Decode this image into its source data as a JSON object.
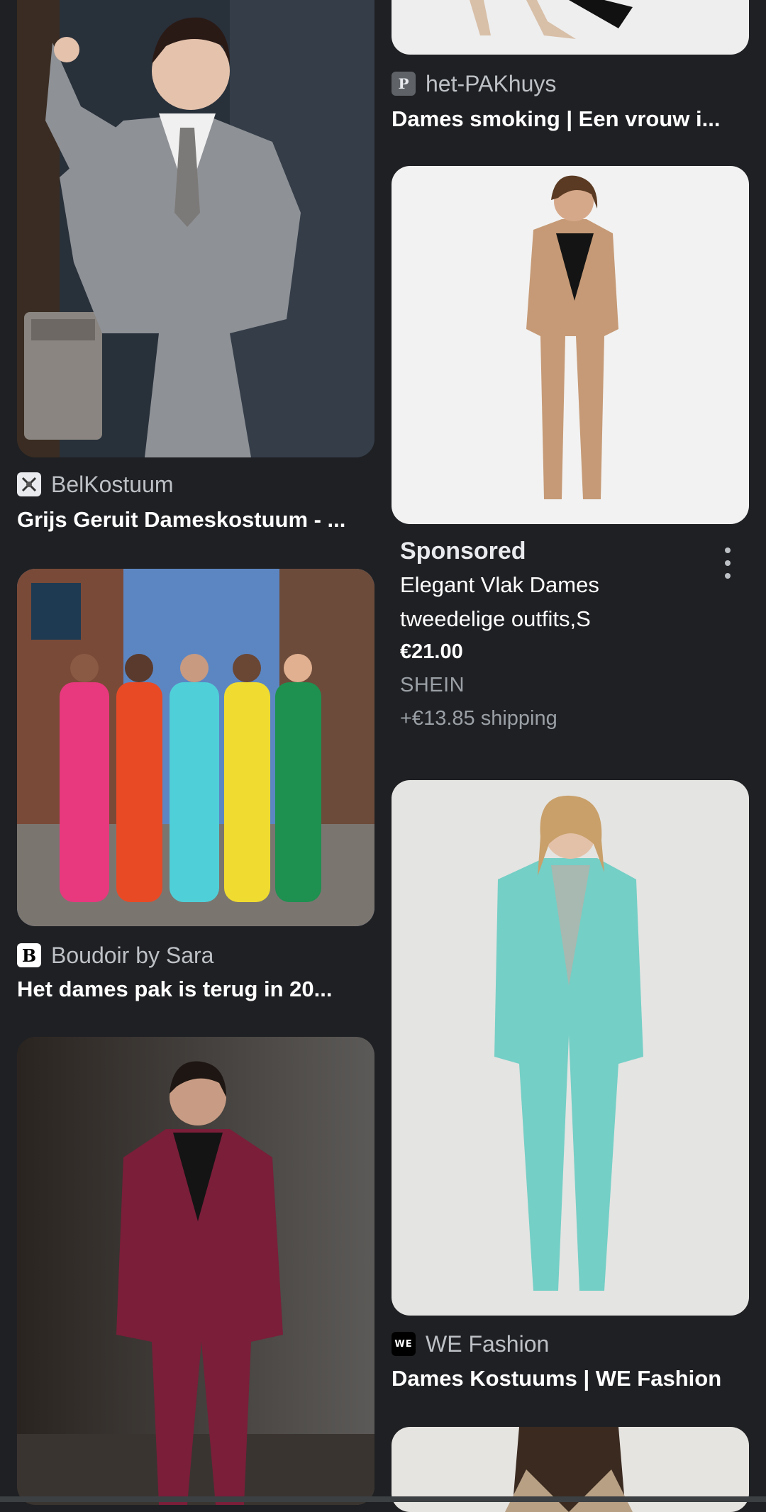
{
  "results": [
    {
      "source": "BelKostuum",
      "title": "Grijs Geruit Dameskostuum - ...",
      "favicon": "belkostuum-logo-icon"
    },
    {
      "source": "Boudoir by Sara",
      "title": "Het dames pak is terug in 20...",
      "favicon_letter": "B"
    },
    {
      "source": "het-PAKhuys",
      "title": "Dames smoking | Een vrouw i...",
      "favicon_letter": "P"
    },
    {
      "source": "WE Fashion",
      "title": "Dames Kostuums | WE Fashion",
      "favicon_letter": "WE"
    }
  ],
  "sponsored": {
    "label": "Sponsored",
    "title_line1": "Elegant Vlak Dames",
    "title_line2": "tweedelige outfits,S",
    "price": "€21.00",
    "store": "SHEIN",
    "shipping": "+€13.85 shipping"
  },
  "colors": {
    "background": "#1f2023",
    "text": "#ffffff",
    "muted": "#bdc1c6"
  }
}
